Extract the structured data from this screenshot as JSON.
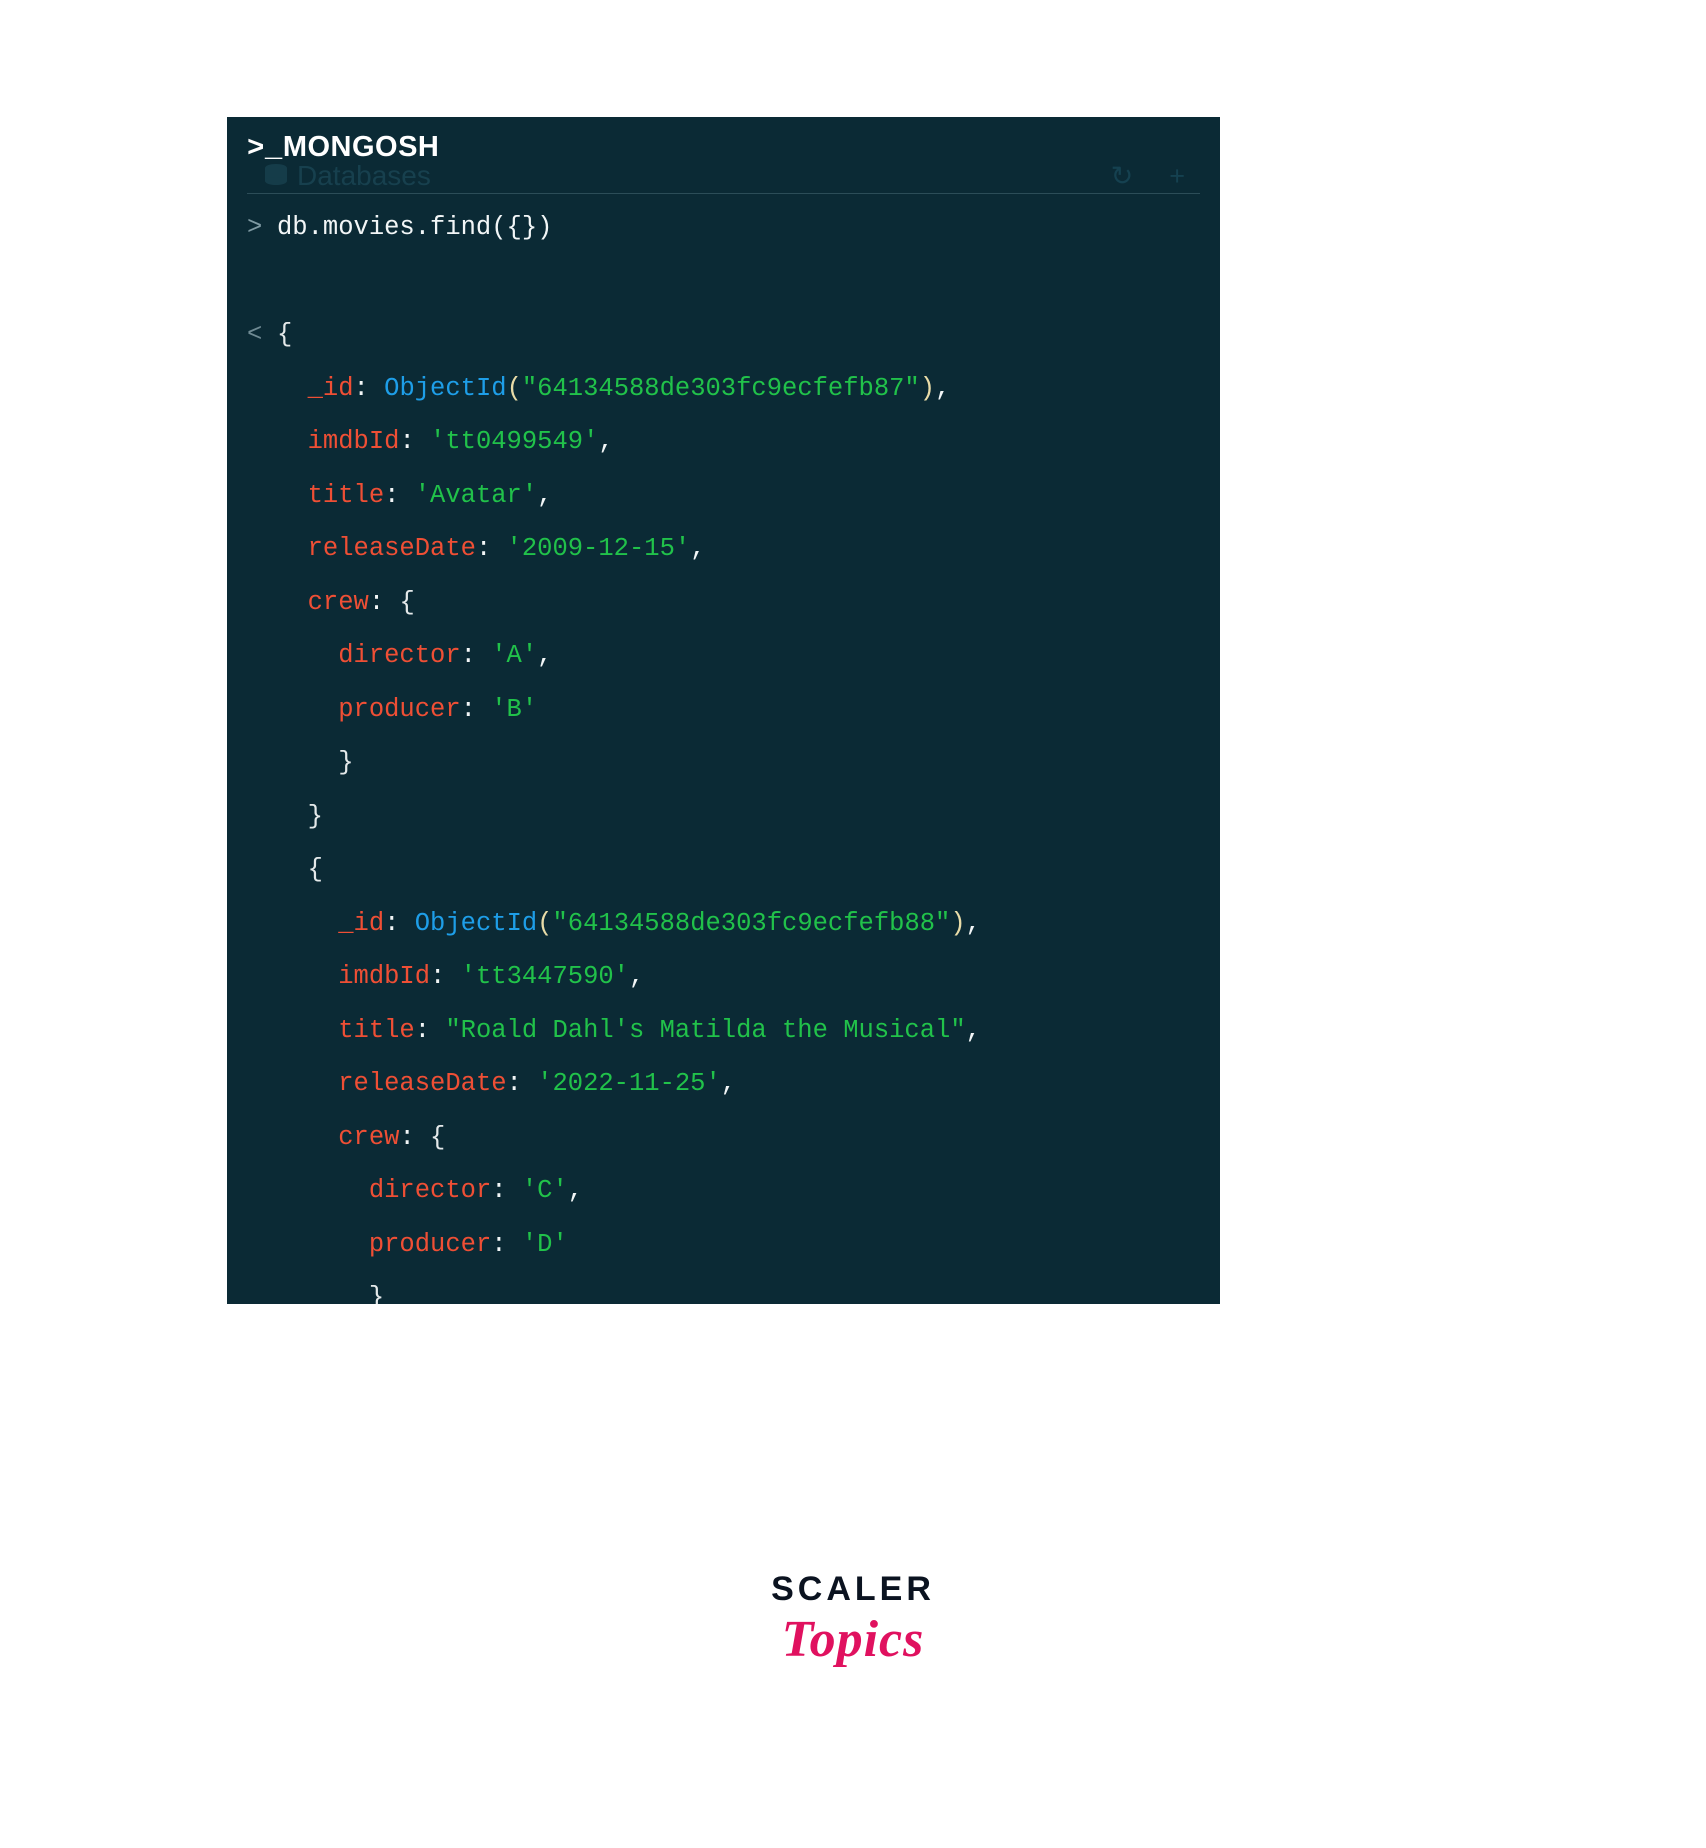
{
  "window": {
    "title": "MONGOSH",
    "prompt_glyph": ">_",
    "ghost_nav_label": "Databases",
    "ghost_refresh_icon": "↻",
    "ghost_plus_icon": "+",
    "background_color": "#0b2a35",
    "accent_colors": {
      "key": "#ef4f35",
      "string": "#21c24a",
      "function": "#1e9ee8",
      "punctuation": "#f2f6f7",
      "paren": "#e9dca8"
    }
  },
  "terminal": {
    "input_prompt": ">",
    "output_prompt": "<",
    "command": "db.movies.find({})",
    "lines": [
      {
        "gutter": ">",
        "type": "input",
        "indent": 0,
        "tokens": [
          {
            "t": "db.movies.find({})",
            "c": "cmd"
          }
        ]
      },
      {
        "gutter": "",
        "type": "blank",
        "indent": 0,
        "tokens": []
      },
      {
        "gutter": "<",
        "type": "output",
        "indent": 0,
        "tokens": [
          {
            "t": "{",
            "c": "brace"
          }
        ]
      },
      {
        "gutter": "",
        "type": "output",
        "indent": 1,
        "tokens": [
          {
            "t": "_id",
            "c": "key"
          },
          {
            "t": ": ",
            "c": "punct"
          },
          {
            "t": "ObjectId",
            "c": "fn"
          },
          {
            "t": "(",
            "c": "paren"
          },
          {
            "t": "\"64134588de303fc9ecfefb87\"",
            "c": "str"
          },
          {
            "t": ")",
            "c": "paren"
          },
          {
            "t": ",",
            "c": "punct"
          }
        ]
      },
      {
        "gutter": "",
        "type": "output",
        "indent": 1,
        "tokens": [
          {
            "t": "imdbId",
            "c": "key"
          },
          {
            "t": ": ",
            "c": "punct"
          },
          {
            "t": "'tt0499549'",
            "c": "str"
          },
          {
            "t": ",",
            "c": "punct"
          }
        ]
      },
      {
        "gutter": "",
        "type": "output",
        "indent": 1,
        "tokens": [
          {
            "t": "title",
            "c": "key"
          },
          {
            "t": ": ",
            "c": "punct"
          },
          {
            "t": "'Avatar'",
            "c": "str"
          },
          {
            "t": ",",
            "c": "punct"
          }
        ]
      },
      {
        "gutter": "",
        "type": "output",
        "indent": 1,
        "tokens": [
          {
            "t": "releaseDate",
            "c": "key"
          },
          {
            "t": ": ",
            "c": "punct"
          },
          {
            "t": "'2009-12-15'",
            "c": "str"
          },
          {
            "t": ",",
            "c": "punct"
          }
        ]
      },
      {
        "gutter": "",
        "type": "output",
        "indent": 1,
        "tokens": [
          {
            "t": "crew",
            "c": "key"
          },
          {
            "t": ": ",
            "c": "punct"
          },
          {
            "t": "{",
            "c": "brace"
          }
        ]
      },
      {
        "gutter": "",
        "type": "output",
        "indent": 2,
        "tokens": [
          {
            "t": "director",
            "c": "key"
          },
          {
            "t": ": ",
            "c": "punct"
          },
          {
            "t": "'A'",
            "c": "str"
          },
          {
            "t": ",",
            "c": "punct"
          }
        ]
      },
      {
        "gutter": "",
        "type": "output",
        "indent": 2,
        "tokens": [
          {
            "t": "producer",
            "c": "key"
          },
          {
            "t": ": ",
            "c": "punct"
          },
          {
            "t": "'B'",
            "c": "str"
          }
        ]
      },
      {
        "gutter": "",
        "type": "output",
        "indent": 2,
        "tokens": [
          {
            "t": "}",
            "c": "brace"
          }
        ]
      },
      {
        "gutter": "",
        "type": "output",
        "indent": 1,
        "tokens": [
          {
            "t": "}",
            "c": "brace"
          }
        ]
      },
      {
        "gutter": "",
        "type": "output",
        "indent": 1,
        "tokens": [
          {
            "t": "{",
            "c": "brace"
          }
        ]
      },
      {
        "gutter": "",
        "type": "output",
        "indent": 2,
        "tokens": [
          {
            "t": "_id",
            "c": "key"
          },
          {
            "t": ": ",
            "c": "punct"
          },
          {
            "t": "ObjectId",
            "c": "fn"
          },
          {
            "t": "(",
            "c": "paren"
          },
          {
            "t": "\"64134588de303fc9ecfefb88\"",
            "c": "str"
          },
          {
            "t": ")",
            "c": "paren"
          },
          {
            "t": ",",
            "c": "punct"
          }
        ]
      },
      {
        "gutter": "",
        "type": "output",
        "indent": 2,
        "tokens": [
          {
            "t": "imdbId",
            "c": "key"
          },
          {
            "t": ": ",
            "c": "punct"
          },
          {
            "t": "'tt3447590'",
            "c": "str"
          },
          {
            "t": ",",
            "c": "punct"
          }
        ]
      },
      {
        "gutter": "",
        "type": "output",
        "indent": 2,
        "tokens": [
          {
            "t": "title",
            "c": "key"
          },
          {
            "t": ": ",
            "c": "punct"
          },
          {
            "t": "\"Roald Dahl's Matilda the Musical\"",
            "c": "str"
          },
          {
            "t": ",",
            "c": "punct"
          }
        ]
      },
      {
        "gutter": "",
        "type": "output",
        "indent": 2,
        "tokens": [
          {
            "t": "releaseDate",
            "c": "key"
          },
          {
            "t": ": ",
            "c": "punct"
          },
          {
            "t": "'2022-11-25'",
            "c": "str"
          },
          {
            "t": ",",
            "c": "punct"
          }
        ]
      },
      {
        "gutter": "",
        "type": "output",
        "indent": 2,
        "tokens": [
          {
            "t": "crew",
            "c": "key"
          },
          {
            "t": ": ",
            "c": "punct"
          },
          {
            "t": "{",
            "c": "brace"
          }
        ]
      },
      {
        "gutter": "",
        "type": "output",
        "indent": 3,
        "tokens": [
          {
            "t": "director",
            "c": "key"
          },
          {
            "t": ": ",
            "c": "punct"
          },
          {
            "t": "'C'",
            "c": "str"
          },
          {
            "t": ",",
            "c": "punct"
          }
        ]
      },
      {
        "gutter": "",
        "type": "output",
        "indent": 3,
        "tokens": [
          {
            "t": "producer",
            "c": "key"
          },
          {
            "t": ": ",
            "c": "punct"
          },
          {
            "t": "'D'",
            "c": "str"
          }
        ]
      },
      {
        "gutter": "",
        "type": "output",
        "indent": 3,
        "tokens": [
          {
            "t": "}",
            "c": "brace"
          }
        ]
      },
      {
        "gutter": "",
        "type": "output",
        "indent": 2,
        "tokens": [
          {
            "t": "}",
            "c": "brace"
          }
        ]
      }
    ],
    "documents": [
      {
        "_id": "ObjectId(\"64134588de303fc9ecfefb87\")",
        "imdbId": "tt0499549",
        "title": "Avatar",
        "releaseDate": "2009-12-15",
        "crew": {
          "director": "A",
          "producer": "B"
        }
      },
      {
        "_id": "ObjectId(\"64134588de303fc9ecfefb88\")",
        "imdbId": "tt3447590",
        "title": "Roald Dahl's Matilda the Musical",
        "releaseDate": "2022-11-25",
        "crew": {
          "director": "C",
          "producer": "D"
        }
      }
    ]
  },
  "logo": {
    "primary": "SCALER",
    "secondary": "Topics",
    "primary_color": "#0b1320",
    "secondary_color": "#e0115f"
  }
}
